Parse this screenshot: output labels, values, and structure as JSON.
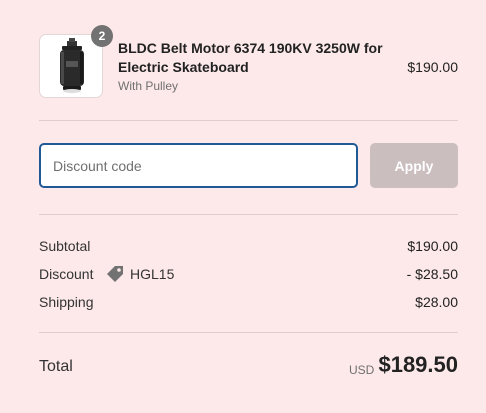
{
  "line_item": {
    "quantity": "2",
    "title": "BLDC Belt Motor 6374 190KV 3250W for Electric Skateboard",
    "variant": "With Pulley",
    "price": "$190.00",
    "image_icon": "motor-product-image"
  },
  "discount": {
    "placeholder": "Discount code",
    "value": "",
    "apply_label": "Apply"
  },
  "summary": {
    "subtotal_label": "Subtotal",
    "subtotal_value": "$190.00",
    "discount_label": "Discount",
    "discount_code": "HGL15",
    "discount_icon": "tag-icon",
    "discount_value": "- $28.50",
    "shipping_label": "Shipping",
    "shipping_value": "$28.00"
  },
  "total": {
    "label": "Total",
    "currency": "USD",
    "amount": "$189.50"
  },
  "colors": {
    "background": "#fde9ea",
    "focus_border": "#1f5a96",
    "apply_disabled": "#cbbebf",
    "badge": "#727272"
  }
}
